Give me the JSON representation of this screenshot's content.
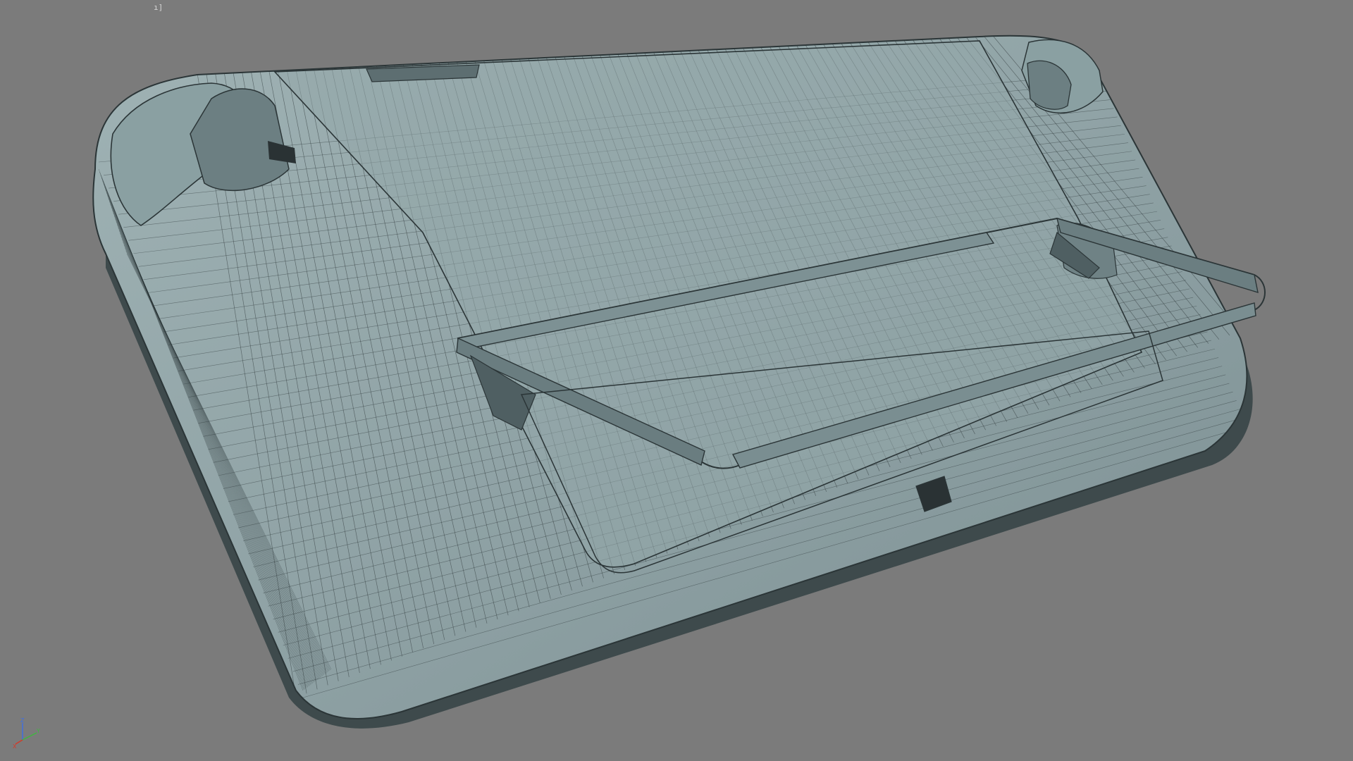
{
  "viewport": {
    "corner_label": "ı]",
    "background": "#7b7b7b",
    "model_fill": "#8fa3a5",
    "model_dark": "#5e6f72",
    "wire_color": "#2b3537"
  },
  "gizmo": {
    "x": "X",
    "y": "Y",
    "z": "Z",
    "x_color": "#d23a2a",
    "y_color": "#3fb83f",
    "z_color": "#3f6fe0"
  }
}
